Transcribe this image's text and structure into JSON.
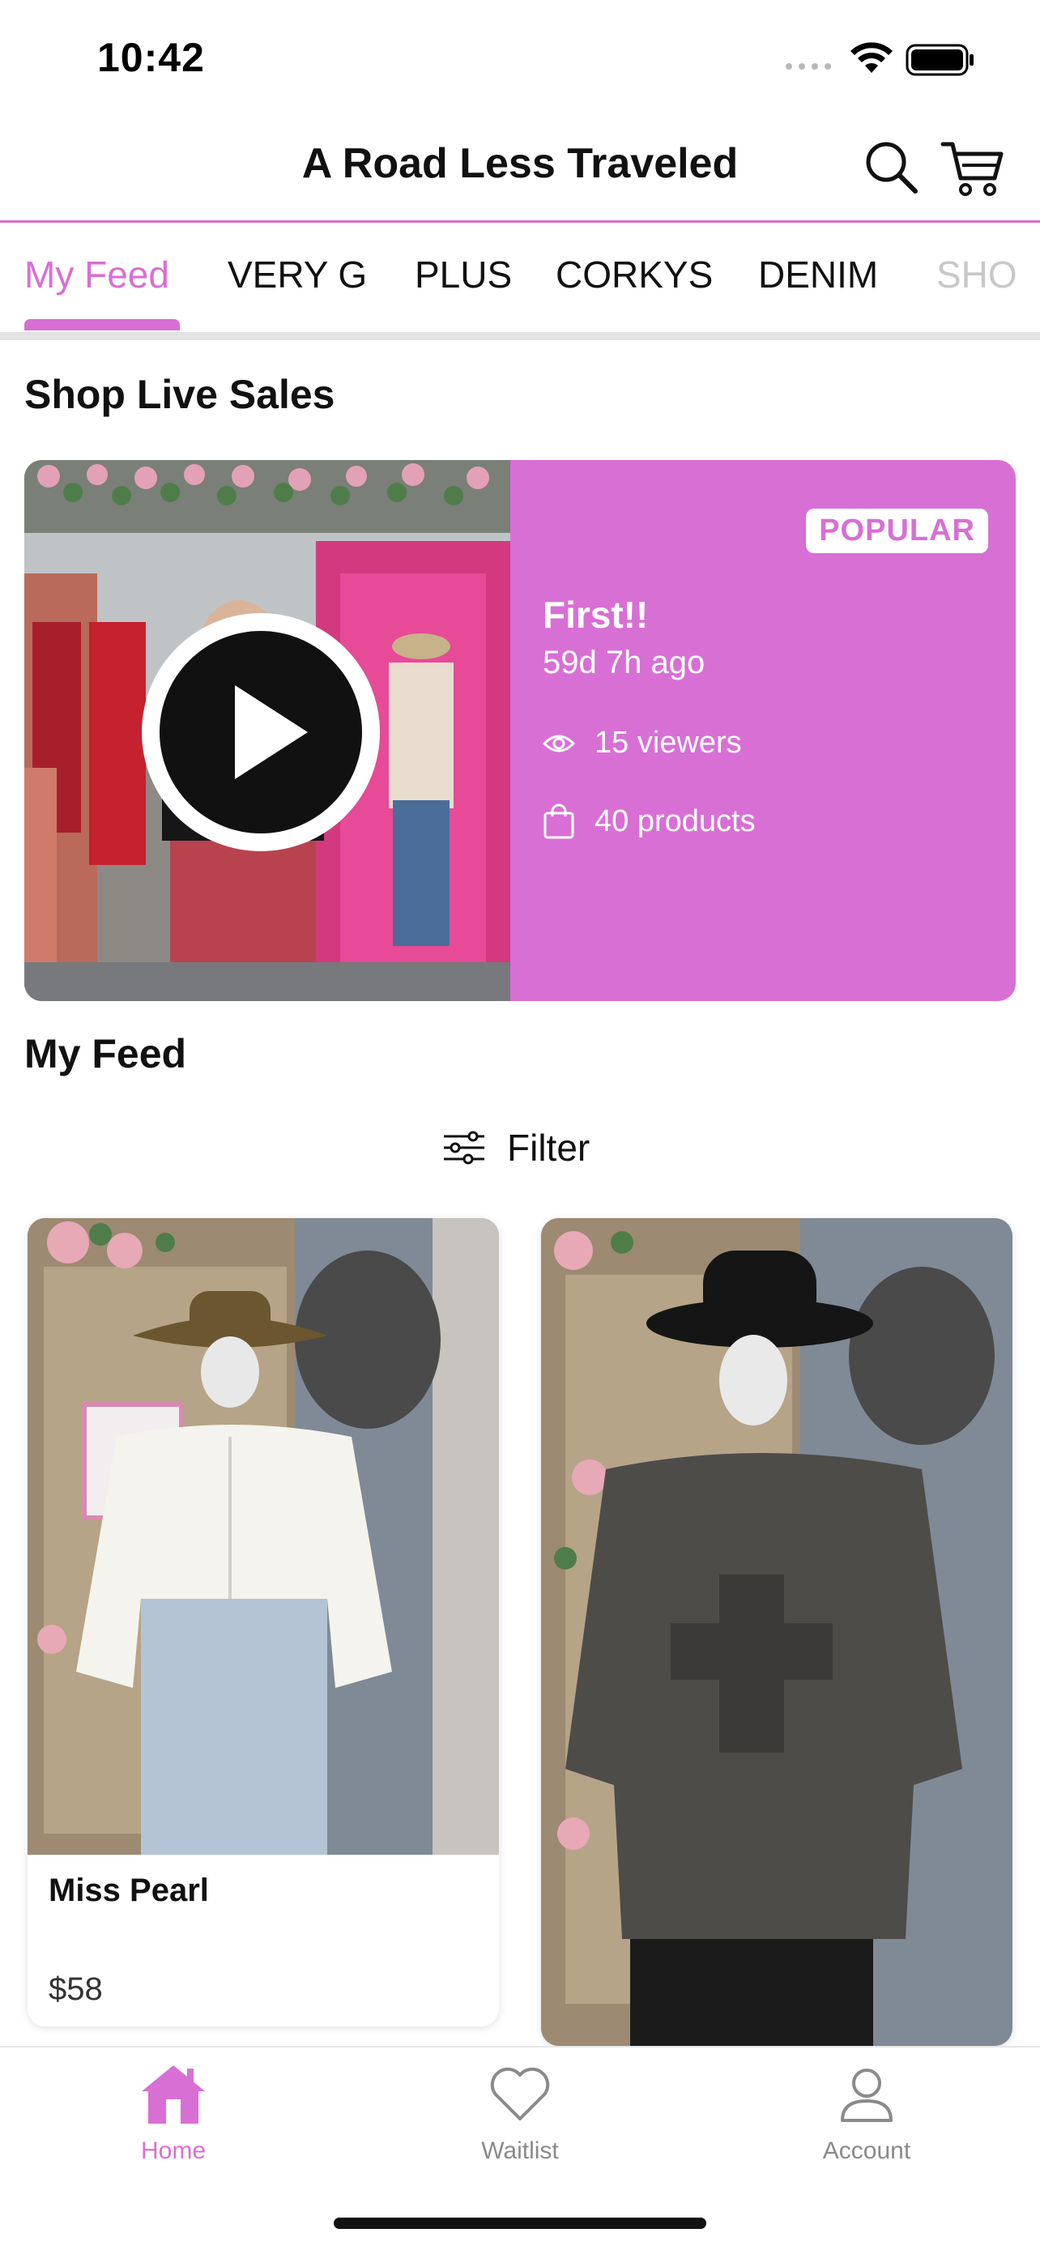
{
  "status_bar": {
    "time": "10:42"
  },
  "header": {
    "title": "A Road Less Traveled",
    "icons": [
      "search-icon",
      "cart-icon"
    ]
  },
  "tabs": {
    "items": [
      "My Feed",
      "VERY G",
      "PLUS",
      "CORKYS",
      "DENIM",
      "SHO"
    ],
    "active_index": 0
  },
  "live_sales": {
    "section_title": "Shop Live Sales",
    "card": {
      "badge": "POPULAR",
      "title": "First!!",
      "time_ago": "59d 7h ago",
      "viewers": "15 viewers",
      "products": "40 products"
    }
  },
  "feed": {
    "section_title": "My Feed",
    "filter_label": "Filter",
    "products": [
      {
        "name": "Miss Pearl",
        "price": "$58"
      },
      {
        "name": "",
        "price": ""
      }
    ]
  },
  "bottom_nav": {
    "items": [
      {
        "label": "Home",
        "icon": "home-icon",
        "active": true
      },
      {
        "label": "Waitlist",
        "icon": "heart-icon",
        "active": false
      },
      {
        "label": "Account",
        "icon": "user-icon",
        "active": false
      }
    ]
  },
  "colors": {
    "accent": "#d86fd5",
    "tab_divider": "#e3e3e3",
    "inactive_nav": "#8a8a8a"
  }
}
